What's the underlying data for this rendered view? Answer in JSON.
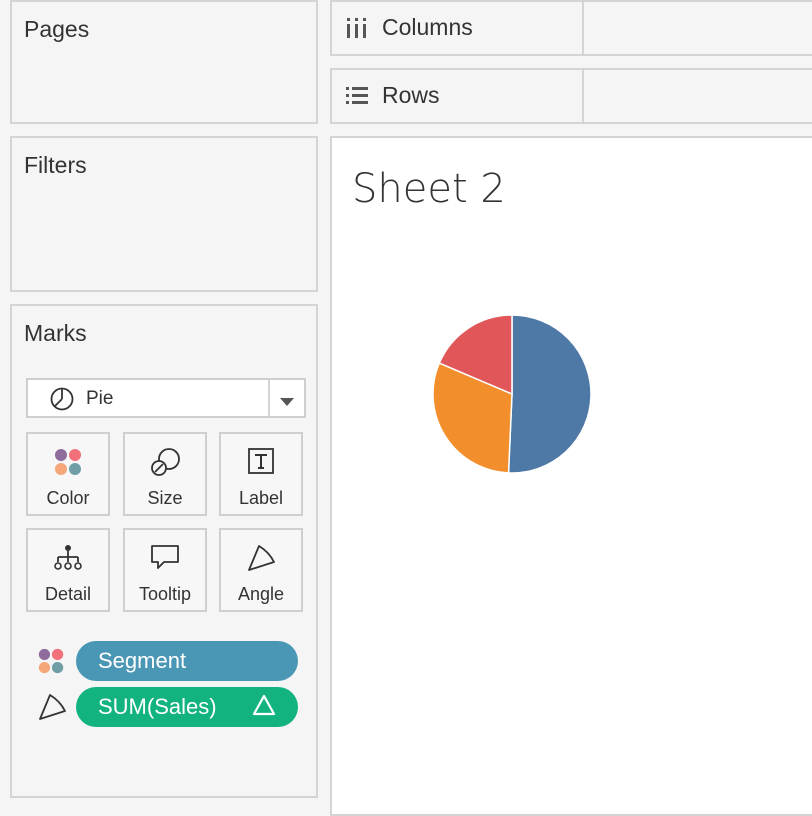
{
  "panels": {
    "pages_title": "Pages",
    "filters_title": "Filters",
    "marks_title": "Marks"
  },
  "shelves": {
    "columns_label": "Columns",
    "rows_label": "Rows"
  },
  "view": {
    "sheet_title": "Sheet 2"
  },
  "marks": {
    "mark_type": "Pie",
    "buttons": {
      "color": "Color",
      "size": "Size",
      "label": "Label",
      "detail": "Detail",
      "tooltip": "Tooltip",
      "angle": "Angle"
    },
    "fields": {
      "color_field": "SUM(Sales)",
      "segment_field": "Segment"
    }
  },
  "colors": {
    "pie_blue": "#4e79a7",
    "pie_orange": "#f28e2b",
    "pie_red": "#e15759",
    "pill_dimension": "#4a97b5",
    "pill_measure": "#12b381"
  },
  "chart_data": {
    "type": "pie",
    "slices": [
      {
        "color": "#4e79a7",
        "value": 50.7
      },
      {
        "color": "#f28e2b",
        "value": 30.7
      },
      {
        "color": "#e15759",
        "value": 18.6
      }
    ]
  }
}
